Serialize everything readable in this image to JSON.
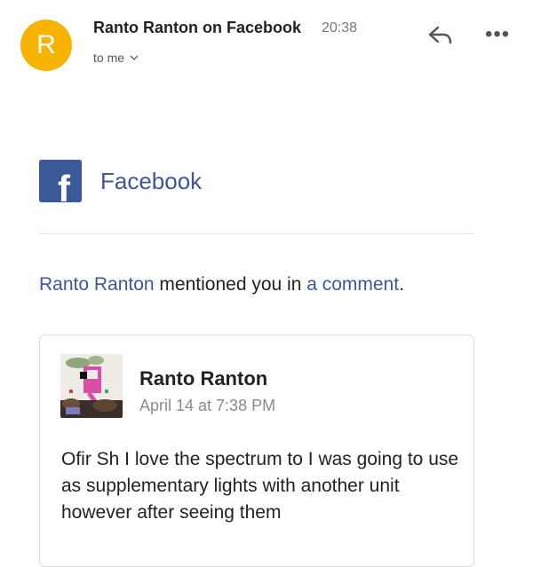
{
  "header": {
    "avatar_letter": "R",
    "avatar_color": "#f6b400",
    "sender": "Ranto Ranton on Facebook",
    "time": "20:38",
    "recipient": "to me",
    "reply_icon": "reply-icon",
    "more_icon": "more-horizontal-icon",
    "more_label": "•••"
  },
  "brand": {
    "name": "Facebook",
    "logo_letter": "f",
    "color": "#3b5998"
  },
  "notification": {
    "actor": "Ranto Ranton",
    "action": " mentioned you in ",
    "target": "a comment",
    "period": "."
  },
  "comment": {
    "author": "Ranto Ranton",
    "date": "April 14 at 7:38 PM",
    "text": "Ofir Sh I love the spectrum to I was going to use as supplementary lights with another unit however after seeing them"
  }
}
